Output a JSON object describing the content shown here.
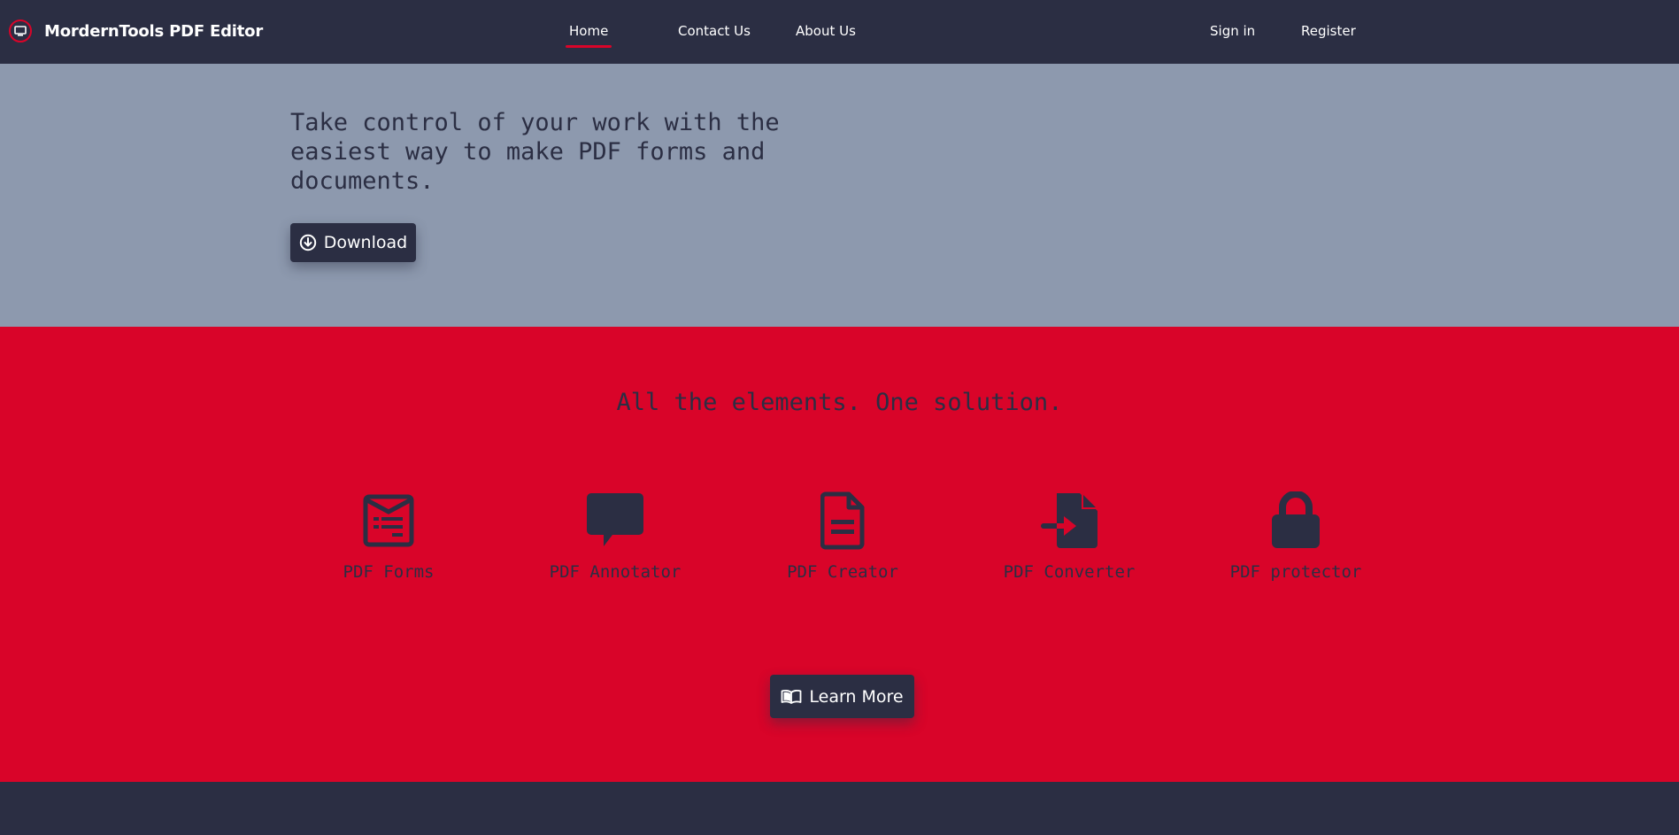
{
  "nav": {
    "brand": "MordernTools PDF Editor",
    "brand_icon": "monitor-icon",
    "links": [
      {
        "label": "Home",
        "active": true
      },
      {
        "label": "Contact Us",
        "active": false
      },
      {
        "label": "About Us",
        "active": false
      }
    ],
    "sign_in": "Sign in",
    "register": "Register"
  },
  "hero": {
    "title": "Take control of your work with the easiest way to make PDF forms and documents.",
    "download_label": "Download",
    "download_icon": "arrow-down-circle-icon"
  },
  "features": {
    "heading": "All the elements. One solution.",
    "items": [
      {
        "label": "PDF Forms",
        "icon": "form-icon"
      },
      {
        "label": "PDF Annotator",
        "icon": "comment-icon"
      },
      {
        "label": "PDF Creator",
        "icon": "document-icon"
      },
      {
        "label": "PDF Converter",
        "icon": "file-import-icon"
      },
      {
        "label": "PDF protector",
        "icon": "lock-icon"
      }
    ],
    "learn_more_label": "Learn More",
    "learn_more_icon": "book-icon"
  },
  "colors": {
    "dark": "#2b2e43",
    "accent": "#d90429",
    "hero_bg": "#8d99ae"
  }
}
